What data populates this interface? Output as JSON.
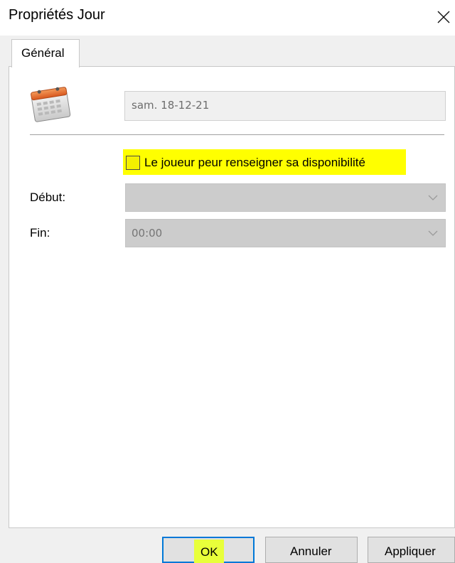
{
  "window": {
    "title": "Propriétés Jour",
    "close_icon": "close-icon"
  },
  "tabs": [
    {
      "label": "Général",
      "selected": true
    }
  ],
  "general": {
    "calendar_icon": "calendar-icon",
    "date_value": "sam. 18-12-21",
    "checkbox": {
      "label": "Le joueur peur renseigner sa disponibilité",
      "checked": false,
      "highlight_color": "#ffff00"
    },
    "debut": {
      "label": "Début:",
      "value": ""
    },
    "fin": {
      "label": "Fin:",
      "value": "00:00"
    }
  },
  "buttons": {
    "ok": "OK",
    "annuler": "Annuler",
    "appliquer": "Appliquer"
  },
  "colors": {
    "accent": "#0078d7",
    "highlight": "#ffff00"
  }
}
